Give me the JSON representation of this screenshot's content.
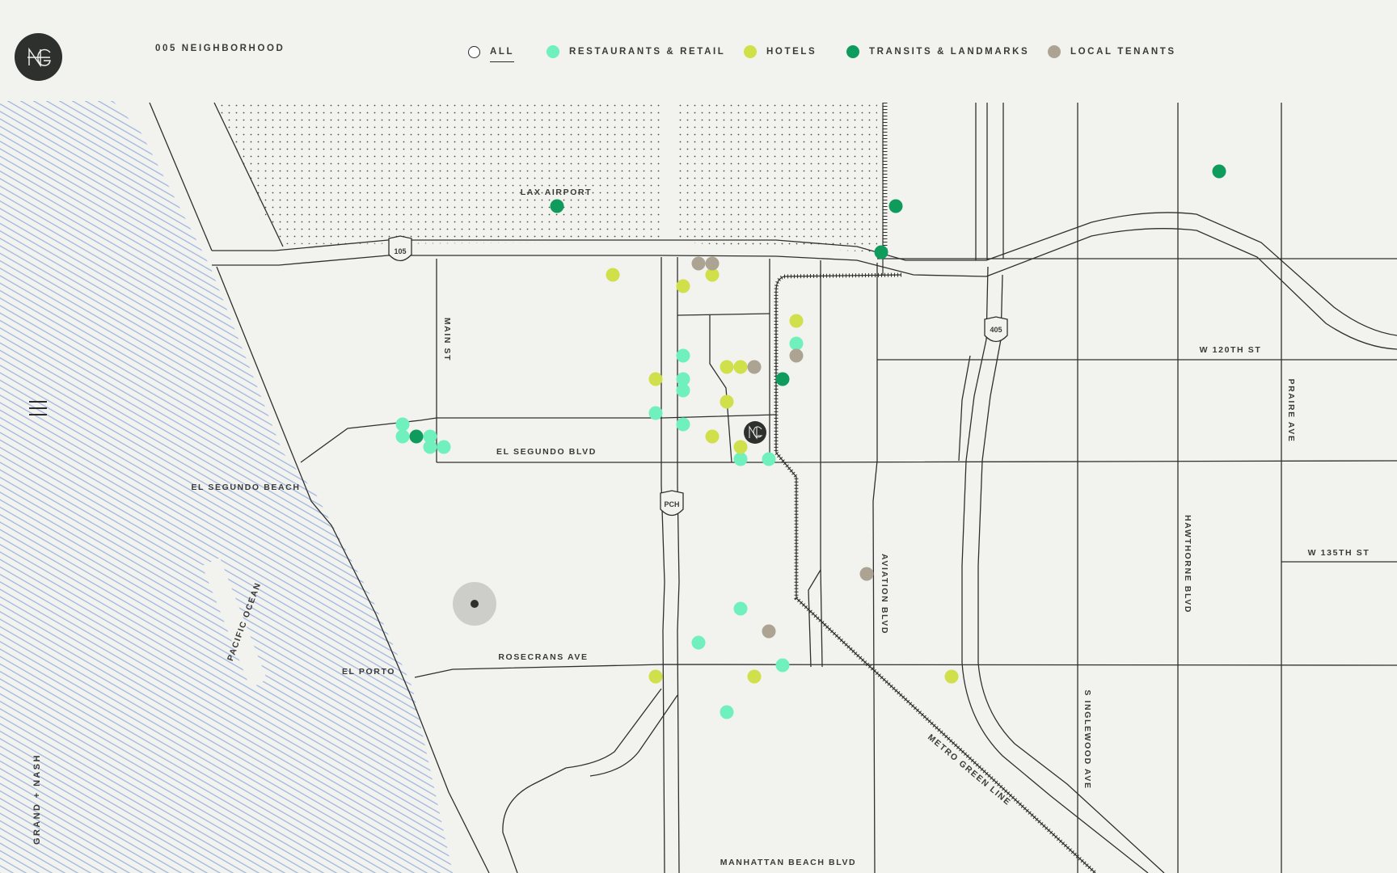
{
  "header": {
    "section_title": "005 NEIGHBORHOOD",
    "filters": [
      {
        "label": "ALL",
        "color": "#ffffff",
        "active": true
      },
      {
        "label": "RESTAURANTS & RETAIL",
        "color": "#6ff0bd"
      },
      {
        "label": "HOTELS",
        "color": "#cfe04a"
      },
      {
        "label": "TRANSITS & LANDMARKS",
        "color": "#0f9b5c"
      },
      {
        "label": "LOCAL TENANTS",
        "color": "#aca393"
      }
    ]
  },
  "sidebar": {
    "brand": "GRAND + NASH"
  },
  "map": {
    "labels": {
      "lax": "LAX AIRPORT",
      "i105": "105",
      "i405": "405",
      "pch": "PCH",
      "main": "MAIN ST",
      "elseg_blvd": "EL SEGUNDO BLVD",
      "elseg_beach": "EL SEGUNDO BEACH",
      "ocean": "PACIFIC OCEAN",
      "elporto": "EL PORTO",
      "rosecrans": "ROSECRANS AVE",
      "manhattan": "MANHATTAN BEACH BLVD",
      "aviation": "AVIATION BLVD",
      "metro": "METRO GREEN LINE",
      "inglewood": "S INGLEWOOD AVE",
      "hawthorne": "HAWTHORNE BLVD",
      "w120": "W 120TH ST",
      "w135": "W 135TH ST",
      "prairie": "PRAIRE AVE"
    },
    "colors": {
      "restaurants": "#6ff0bd",
      "hotels": "#cfe04a",
      "transit": "#0f9b5c",
      "tenants": "#aca393",
      "water": "#9fb7df",
      "road": "#2f2f2f"
    }
  }
}
